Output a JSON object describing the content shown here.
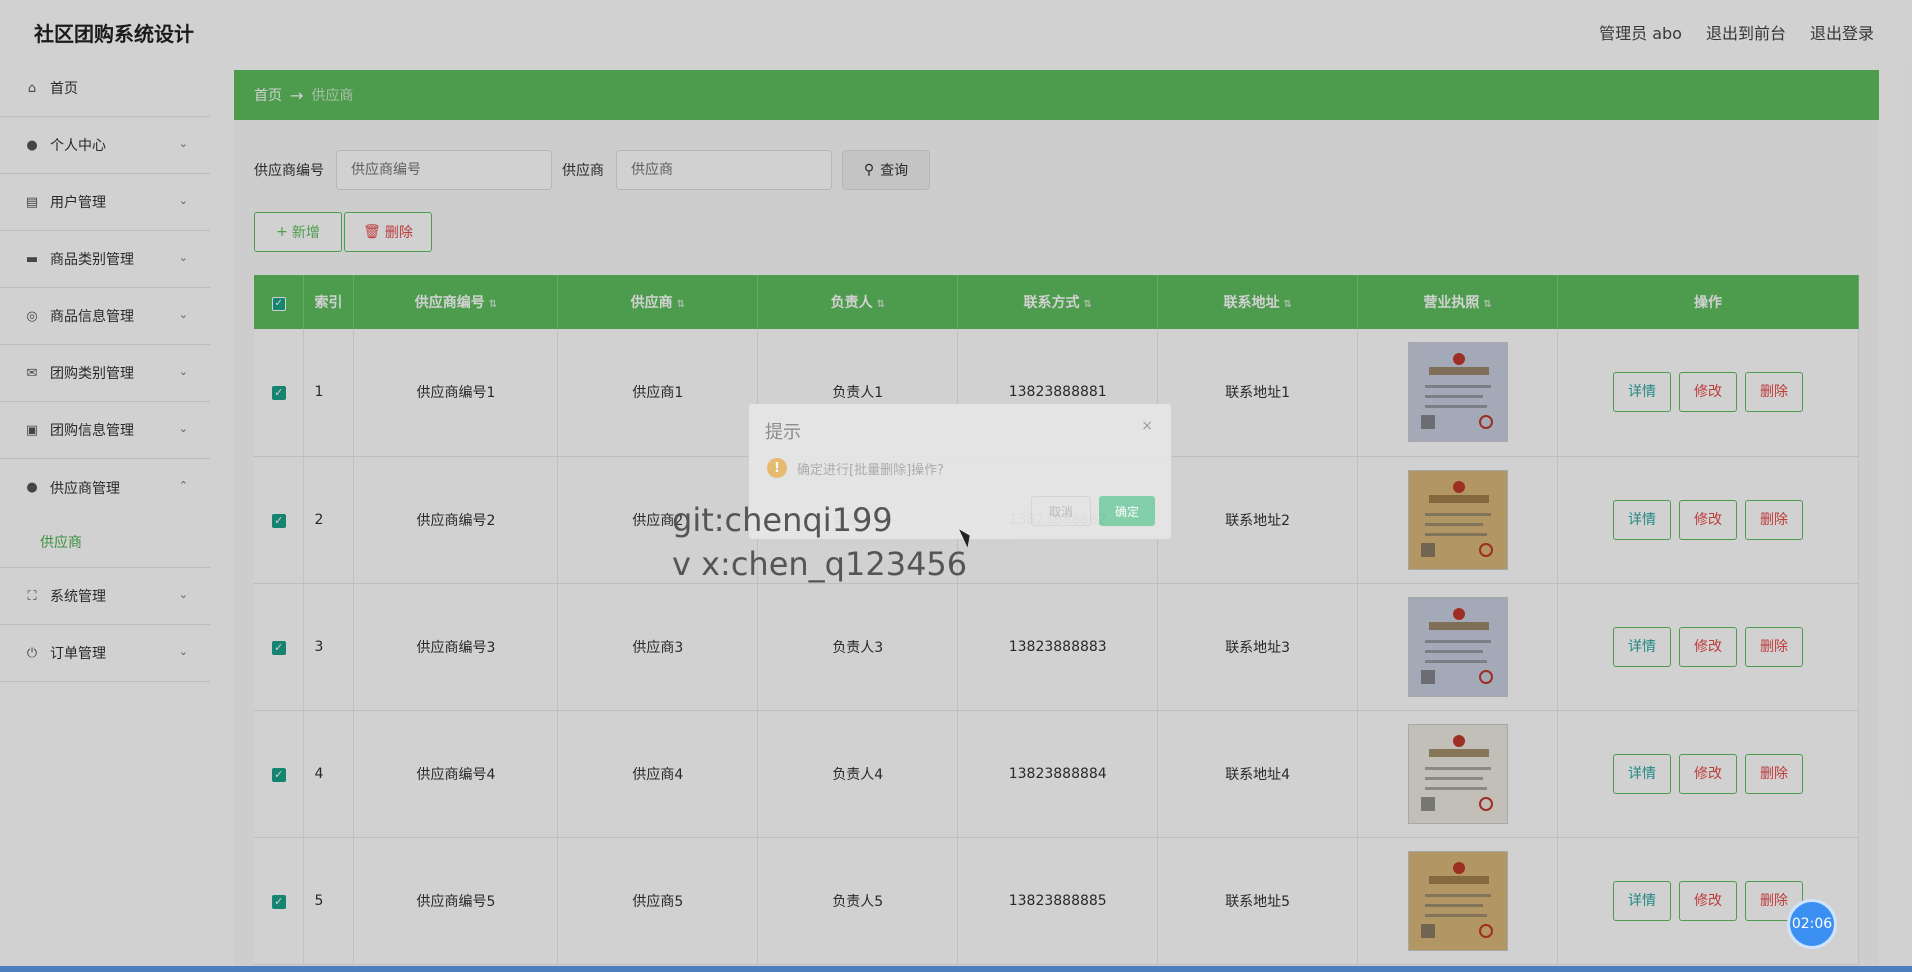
{
  "header": {
    "title": "社区团购系统设计",
    "admin": "管理员 abo",
    "front": "退出到前台",
    "logout": "退出登录"
  },
  "sidebar": {
    "home": "首页",
    "items": [
      {
        "label": "个人中心",
        "icon": "user-icon"
      },
      {
        "label": "用户管理",
        "icon": "chart-icon"
      },
      {
        "label": "商品类别管理",
        "icon": "briefcase-icon"
      },
      {
        "label": "商品信息管理",
        "icon": "target-icon"
      },
      {
        "label": "团购类别管理",
        "icon": "mail-icon"
      },
      {
        "label": "团购信息管理",
        "icon": "clipboard-icon"
      },
      {
        "label": "供应商管理",
        "icon": "user-icon"
      },
      {
        "label": "系统管理",
        "icon": "expand-icon"
      },
      {
        "label": "订单管理",
        "icon": "power-icon"
      }
    ],
    "sub_active": "供应商"
  },
  "breadcrumb": {
    "home": "首页",
    "arrow": "→",
    "current": "供应商"
  },
  "search": {
    "code_label": "供应商编号",
    "code_placeholder": "供应商编号",
    "name_label": "供应商",
    "name_placeholder": "供应商",
    "query": "查询"
  },
  "actions": {
    "add": "新增",
    "delete": "删除"
  },
  "table": {
    "headers": [
      "索引",
      "供应商编号",
      "供应商",
      "负责人",
      "联系方式",
      "联系地址",
      "营业执照",
      "操作"
    ],
    "rows": [
      {
        "idx": "1",
        "code": "供应商编号1",
        "name": "供应商1",
        "owner": "负责人1",
        "phone": "13823888881",
        "addr": "联系地址1",
        "license": "blue"
      },
      {
        "idx": "2",
        "code": "供应商编号2",
        "name": "供应商2",
        "owner": "负责人2",
        "phone": "13823888882",
        "addr": "联系地址2",
        "license": "gold"
      },
      {
        "idx": "3",
        "code": "供应商编号3",
        "name": "供应商3",
        "owner": "负责人3",
        "phone": "13823888883",
        "addr": "联系地址3",
        "license": "blue"
      },
      {
        "idx": "4",
        "code": "供应商编号4",
        "name": "供应商4",
        "owner": "负责人4",
        "phone": "13823888884",
        "addr": "联系地址4",
        "license": "white"
      },
      {
        "idx": "5",
        "code": "供应商编号5",
        "name": "供应商5",
        "owner": "负责人5",
        "phone": "13823888885",
        "addr": "联系地址5",
        "license": "gold"
      }
    ],
    "op_detail": "详情",
    "op_edit": "修改",
    "op_delete": "删除"
  },
  "dialog": {
    "title": "提示",
    "close": "×",
    "message": "确定进行[批量删除]操作?",
    "cancel": "取消",
    "confirm": "确定"
  },
  "watermark": {
    "line1": "git:chenqi199",
    "line2": "v x:chen_q123456"
  },
  "timer": "02:06",
  "colors": {
    "accent": "#5fbf5f",
    "danger": "#e94a4a",
    "checkbox": "#1aa38a"
  }
}
